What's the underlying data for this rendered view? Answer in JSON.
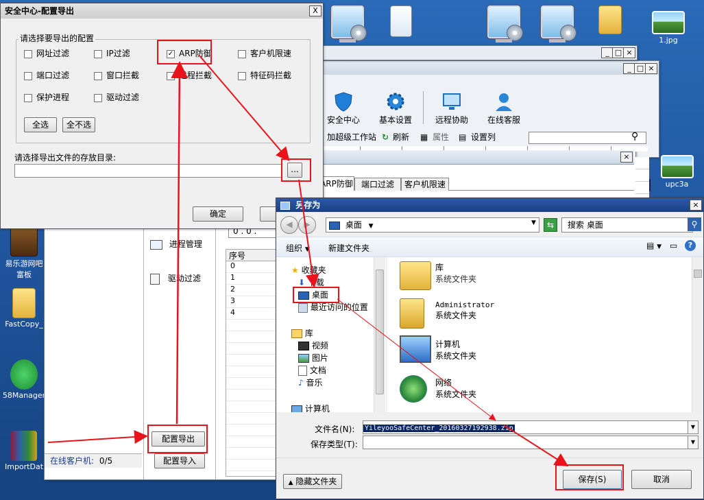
{
  "desktop": {
    "icons_top": [
      {
        "label": "",
        "kind": "monitor"
      },
      {
        "label": "",
        "kind": "doc"
      },
      {
        "label": "",
        "kind": "monitor"
      },
      {
        "label": "",
        "kind": "monitor"
      },
      {
        "label": "",
        "kind": "folder"
      },
      {
        "label": "1.jpg",
        "kind": "image"
      }
    ],
    "icons_left": [
      {
        "label": "易乐游网吧\n富板",
        "kind": "book"
      },
      {
        "label": "FastCopy_",
        "kind": "folder"
      },
      {
        "label": "58Manager",
        "kind": "badge"
      },
      {
        "label": "ImportDat",
        "kind": "archive"
      }
    ],
    "right_icon_label": "upc3a"
  },
  "main_app": {
    "toolbar": [
      {
        "label": "安全中心",
        "icon": "shield-icon"
      },
      {
        "label": "基本设置",
        "icon": "gear-icon"
      },
      {
        "label": "远程协助",
        "icon": "monitor-icon"
      },
      {
        "label": "在线客服",
        "icon": "person-icon"
      }
    ],
    "subbar": {
      "workstation": "加超级工作站",
      "refresh": "刷新",
      "properties": "属性",
      "columns": "设置列"
    },
    "tabs": [
      "ARP防御",
      "端口过滤",
      "客户机限速"
    ],
    "side_items": [
      {
        "label": "进程管理",
        "icon": "process-icon"
      },
      {
        "label": "驱动过滤",
        "icon": "driver-icon"
      }
    ],
    "export_button": "配置导出",
    "import_button": "配置导入",
    "ip_display": "0 . 0 .",
    "table_header": "序号",
    "table_rows": [
      "0",
      "1",
      "2",
      "3",
      "4"
    ],
    "status_online": "在线客户机:",
    "status_count": "0/5"
  },
  "export_dialog": {
    "title": "安全中心-配置导出",
    "group_label": "请选择要导出的配置",
    "checkboxes": [
      {
        "label": "网址过滤",
        "checked": false
      },
      {
        "label": "IP过滤",
        "checked": false
      },
      {
        "label": "ARP防御",
        "checked": true
      },
      {
        "label": "客户机限速",
        "checked": false
      },
      {
        "label": "端口过滤",
        "checked": false
      },
      {
        "label": "窗口拦截",
        "checked": false
      },
      {
        "label": "进程拦截",
        "checked": false
      },
      {
        "label": "特征码拦截",
        "checked": false
      },
      {
        "label": "保护进程",
        "checked": false
      },
      {
        "label": "驱动过滤",
        "checked": false
      }
    ],
    "select_all": "全选",
    "select_none": "全不选",
    "dir_label": "请选择导出文件的存放目录:",
    "dir_value": "",
    "browse_button": "...",
    "ok_button": "确定",
    "close_glyph": "X"
  },
  "save_dialog": {
    "title": "另存为",
    "location": "桌面",
    "search_placeholder": "搜索 桌面",
    "organize": "组织",
    "new_folder": "新建文件夹",
    "nav": [
      {
        "label": "收藏夹",
        "icon": "star-icon",
        "level": 0
      },
      {
        "label": "下载",
        "icon": "download-icon",
        "level": 1
      },
      {
        "label": "桌面",
        "icon": "desktop-icon",
        "level": 1
      },
      {
        "label": "最近访问的位置",
        "icon": "recent-icon",
        "level": 1
      },
      {
        "label": "库",
        "icon": "library-icon",
        "level": 0
      },
      {
        "label": "视频",
        "icon": "video-icon",
        "level": 1
      },
      {
        "label": "图片",
        "icon": "picture-icon",
        "level": 1
      },
      {
        "label": "文档",
        "icon": "document-icon",
        "level": 1
      },
      {
        "label": "音乐",
        "icon": "music-icon",
        "level": 1
      },
      {
        "label": "计算机",
        "icon": "computer-icon",
        "level": 0
      }
    ],
    "files": [
      {
        "name": "库",
        "type": "系统文件夹",
        "icon": "library-folder-icon"
      },
      {
        "name": "Administrator",
        "type": "系统文件夹",
        "icon": "user-folder-icon"
      },
      {
        "name": "计算机",
        "type": "系统文件夹",
        "icon": "computer-icon"
      },
      {
        "name": "网络",
        "type": "系统文件夹",
        "icon": "network-icon"
      }
    ],
    "filename_label": "文件名(N):",
    "filename_value": "YileyooSafeCenter_20160327192938.zip",
    "filetype_label": "保存类型(T):",
    "filetype_value": "",
    "hide_folders": "隐藏文件夹",
    "save_button": "保存(S)",
    "cancel_button": "取消"
  },
  "colors": {
    "annotation": "#e8141b",
    "selection": "#0a246a",
    "desktop": "#1f5aa6"
  }
}
